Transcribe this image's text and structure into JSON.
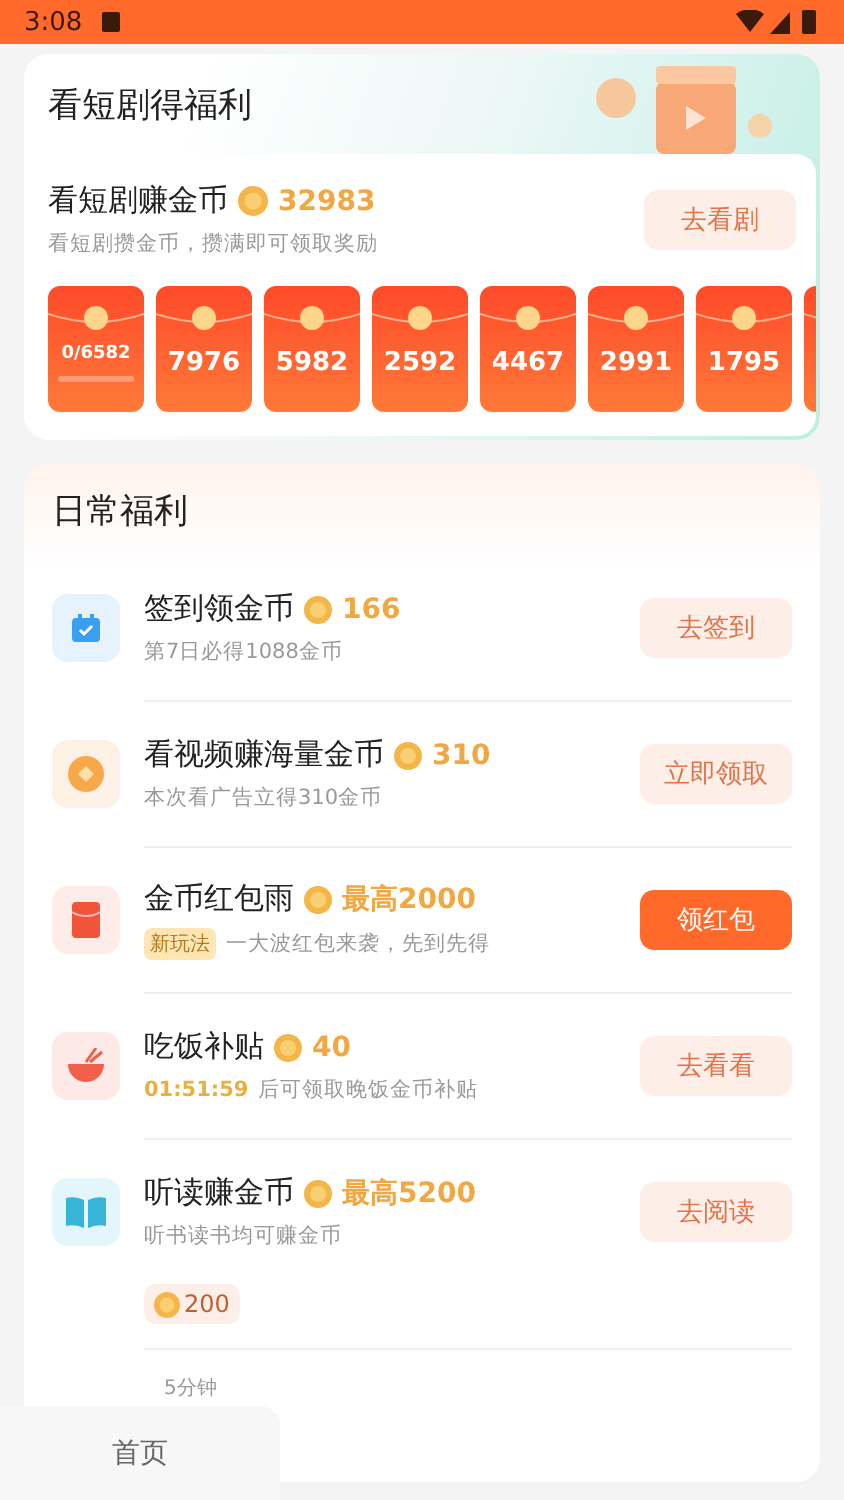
{
  "status_bar": {
    "time": "3:08"
  },
  "drama_card": {
    "title": "看短剧得福利",
    "task": {
      "title": "看短剧赚金币",
      "coins": "32983",
      "subtitle": "看短剧攒金币，攒满即可领取奖励",
      "button": "去看剧"
    },
    "envelopes": [
      {
        "kind": "progress",
        "text": "0/6582",
        "level": 0
      },
      {
        "kind": "amount",
        "text": "7976"
      },
      {
        "kind": "amount",
        "text": "5982"
      },
      {
        "kind": "amount",
        "text": "2592"
      },
      {
        "kind": "amount",
        "text": "4467"
      },
      {
        "kind": "amount",
        "text": "2991"
      },
      {
        "kind": "amount",
        "text": "1795"
      },
      {
        "kind": "partial"
      }
    ]
  },
  "daily": {
    "title": "日常福利",
    "tasks": [
      {
        "kind": "calendar",
        "title": "签到领金币",
        "coins": "166",
        "subtitle": "第7日必得1088金币",
        "button": "去签到",
        "primary": false
      },
      {
        "kind": "coin",
        "title": "看视频赚海量金币",
        "coins": "310",
        "subtitle": "本次看广告立得310金币",
        "button": "立即领取",
        "primary": false
      },
      {
        "kind": "envelope",
        "title": "金币红包雨",
        "coins": "最高2000",
        "tag": "新玩法",
        "subtitle": "一大波红包来袭，先到先得",
        "button": "领红包",
        "primary": true
      },
      {
        "kind": "bowl",
        "title": "吃饭补贴",
        "coins": "40",
        "timer": "01:51:59",
        "subtitle": "后可领取晚饭金币补贴",
        "button": "去看看",
        "primary": false
      },
      {
        "kind": "book",
        "title": "听读赚金币",
        "coins": "最高5200",
        "subtitle": "听书读书均可赚金币",
        "button": "去阅读",
        "primary": false
      }
    ],
    "reading_rewards": [
      {
        "coins": "200",
        "label": "5分钟"
      }
    ]
  },
  "bottom_nav": [
    {
      "label": "首页"
    }
  ]
}
